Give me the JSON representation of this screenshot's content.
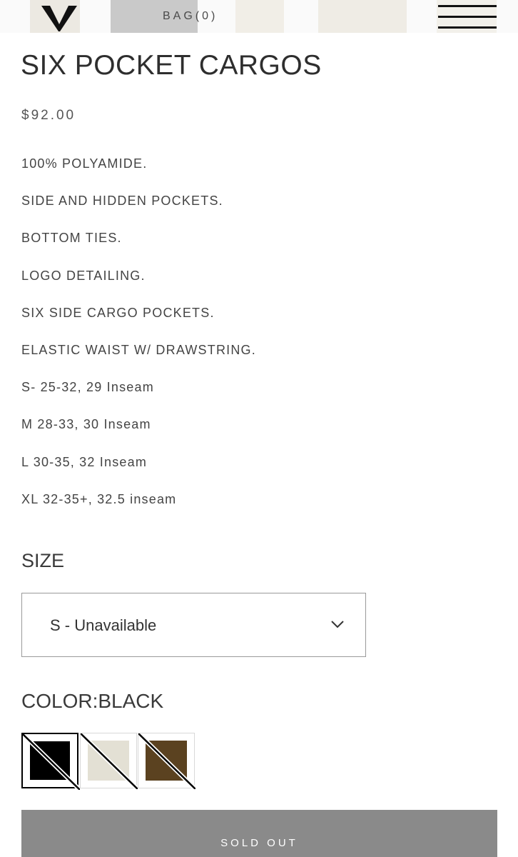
{
  "header": {
    "bag_label": "BAG(0)",
    "logo_icon": "v-logo-icon",
    "menu_icon": "hamburger-menu-icon"
  },
  "product": {
    "title": "SIX POCKET CARGOS",
    "price": "$92.00",
    "details": [
      "100% POLYAMIDE.",
      "SIDE AND HIDDEN POCKETS.",
      "BOTTOM TIES.",
      "LOGO DETAILING.",
      "SIX SIDE CARGO POCKETS.",
      "ELASTIC WAIST W/ DRAWSTRING.",
      "S- 25-32, 29 Inseam",
      "M 28-33, 30 Inseam",
      "L 30-35, 32 Inseam",
      "XL 32-35+, 32.5 inseam"
    ]
  },
  "size": {
    "label": "SIZE",
    "selected": "S - Unavailable"
  },
  "color": {
    "label": "COLOR:BLACK",
    "swatches": [
      {
        "color": "#000000",
        "selected": true,
        "unavailable": true
      },
      {
        "color": "#e3e0d4",
        "selected": false,
        "unavailable": true
      },
      {
        "color": "#5b4220",
        "selected": false,
        "unavailable": true
      }
    ]
  },
  "cta": {
    "label": "SOLD OUT"
  },
  "colors": {
    "button_bg": "#8a8a8a",
    "text": "#3a3a3a"
  }
}
